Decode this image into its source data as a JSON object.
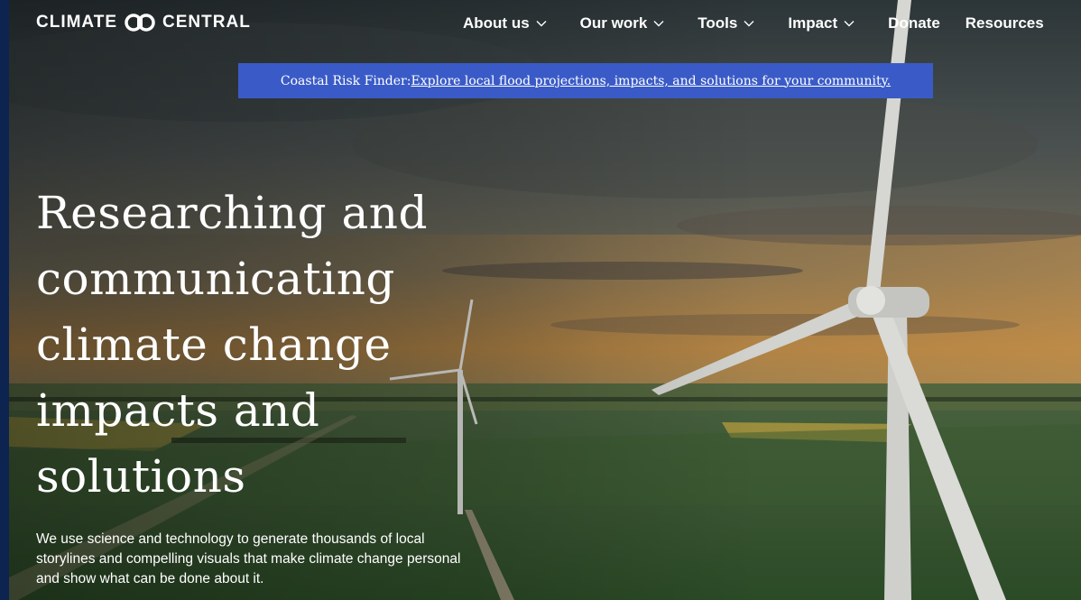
{
  "brand": {
    "name_left": "CLIMATE",
    "name_right": "CENTRAL",
    "logo_icon": "linked-circles-logo"
  },
  "nav": {
    "items": [
      {
        "label": "About us",
        "has_dropdown": true
      },
      {
        "label": "Our work",
        "has_dropdown": true
      },
      {
        "label": "Tools",
        "has_dropdown": true
      },
      {
        "label": "Impact",
        "has_dropdown": true
      },
      {
        "label": "Donate",
        "has_dropdown": false
      },
      {
        "label": "Resources",
        "has_dropdown": false
      }
    ]
  },
  "banner": {
    "prefix": "Coastal Risk Finder:",
    "link_text": " Explore local flood projections, impacts, and solutions for your community.",
    "background": "#3a5bc7"
  },
  "hero": {
    "headline_lines": [
      "Researching and",
      "communicating",
      "climate change",
      "impacts and",
      "solutions"
    ],
    "subtext_lines": [
      "We use science and technology to generate thousands of local",
      "storylines and compelling visuals that make climate change personal",
      "and show what can be done about it."
    ],
    "image": "wind-turbines-over-farmland-photo"
  },
  "colors": {
    "frame": "#0d2350",
    "text": "#ffffff"
  }
}
